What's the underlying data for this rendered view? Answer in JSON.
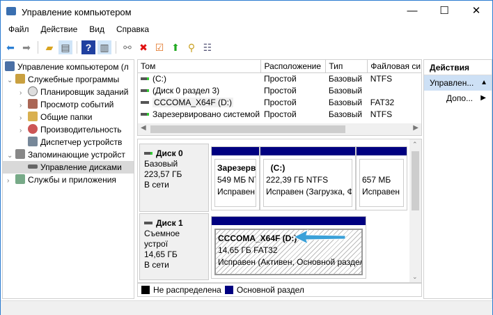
{
  "window": {
    "title": "Управление компьютером",
    "minimize": "—",
    "maximize": "☐",
    "close": "✕"
  },
  "menu": [
    "Файл",
    "Действие",
    "Вид",
    "Справка"
  ],
  "tree": {
    "root": "Управление компьютером (л",
    "items": [
      {
        "label": "Служебные программы",
        "level": 1,
        "expanded": true
      },
      {
        "label": "Планировщик заданий",
        "level": 2
      },
      {
        "label": "Просмотр событий",
        "level": 2
      },
      {
        "label": "Общие папки",
        "level": 2
      },
      {
        "label": "Производительность",
        "level": 2
      },
      {
        "label": "Диспетчер устройств",
        "level": 2
      },
      {
        "label": "Запоминающие устройст",
        "level": 1,
        "expanded": true
      },
      {
        "label": "Управление дисками",
        "level": 2,
        "selected": true
      },
      {
        "label": "Службы и приложения",
        "level": 1
      }
    ]
  },
  "table": {
    "headers": [
      "Том",
      "Расположение",
      "Тип",
      "Файловая си"
    ],
    "rows": [
      [
        "(C:)",
        "Простой",
        "Базовый",
        "NTFS"
      ],
      [
        "(Диск 0 раздел 3)",
        "Простой",
        "Базовый",
        ""
      ],
      [
        "CCCOMA_X64F (D:)",
        "Простой",
        "Базовый",
        "FAT32"
      ],
      [
        "Зарезервировано системой",
        "Простой",
        "Базовый",
        "NTFS"
      ]
    ]
  },
  "disks": [
    {
      "name": "Диск 0",
      "type": "Базовый",
      "size": "223,57 ГБ",
      "status": "В сети",
      "partitions": [
        {
          "title": "Зарезерв",
          "size": "549 МБ NT",
          "status": "Исправен"
        },
        {
          "title": "(C:)",
          "size": "222,39 ГБ NTFS",
          "status": "Исправен (Загрузка, Ф"
        },
        {
          "title": "",
          "size": "657 МБ",
          "status": "Исправен"
        }
      ]
    },
    {
      "name": "Диск 1",
      "type": "Съемное устрої",
      "size": "14,65 ГБ",
      "status": "В сети",
      "partitions": [
        {
          "title": "CCCOMA_X64F  (D:)",
          "size": "14,65 ГБ FAT32",
          "status": "Исправен (Активен, Основной раздел"
        }
      ]
    }
  ],
  "legend": [
    "Не распределена",
    "Основной раздел"
  ],
  "actions": {
    "header": "Действия",
    "group": "Управлен...",
    "more": "Допо..."
  }
}
